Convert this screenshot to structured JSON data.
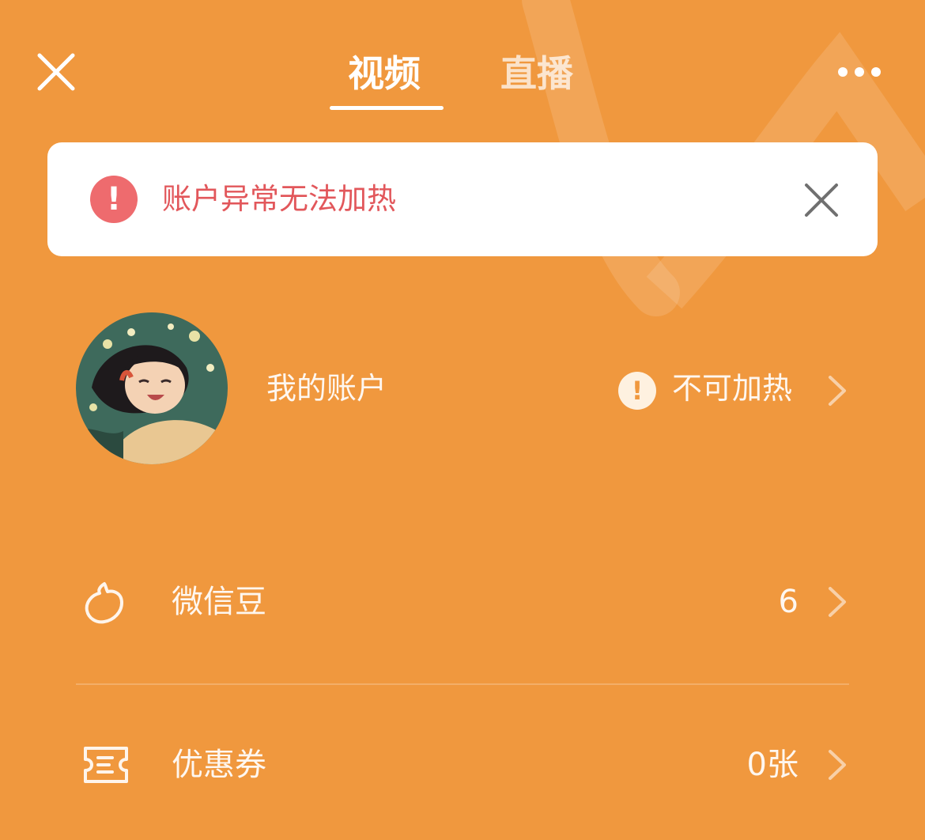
{
  "header": {
    "tabs": [
      {
        "label": "视频",
        "active": true
      },
      {
        "label": "直播",
        "active": false
      }
    ]
  },
  "alert": {
    "message": "账户异常无法加热",
    "icon_glyph": "!"
  },
  "account": {
    "title": "我的账户",
    "status_glyph": "!",
    "status": "不可加热"
  },
  "rows": [
    {
      "label": "微信豆",
      "value": "6",
      "icon": "wechat-bean-icon"
    },
    {
      "label": "优惠券",
      "value": "0张",
      "icon": "coupon-icon"
    }
  ],
  "colors": {
    "background": "#F0983E",
    "alert_red": "#E2575B",
    "alert_icon": "#EE6B6E"
  }
}
